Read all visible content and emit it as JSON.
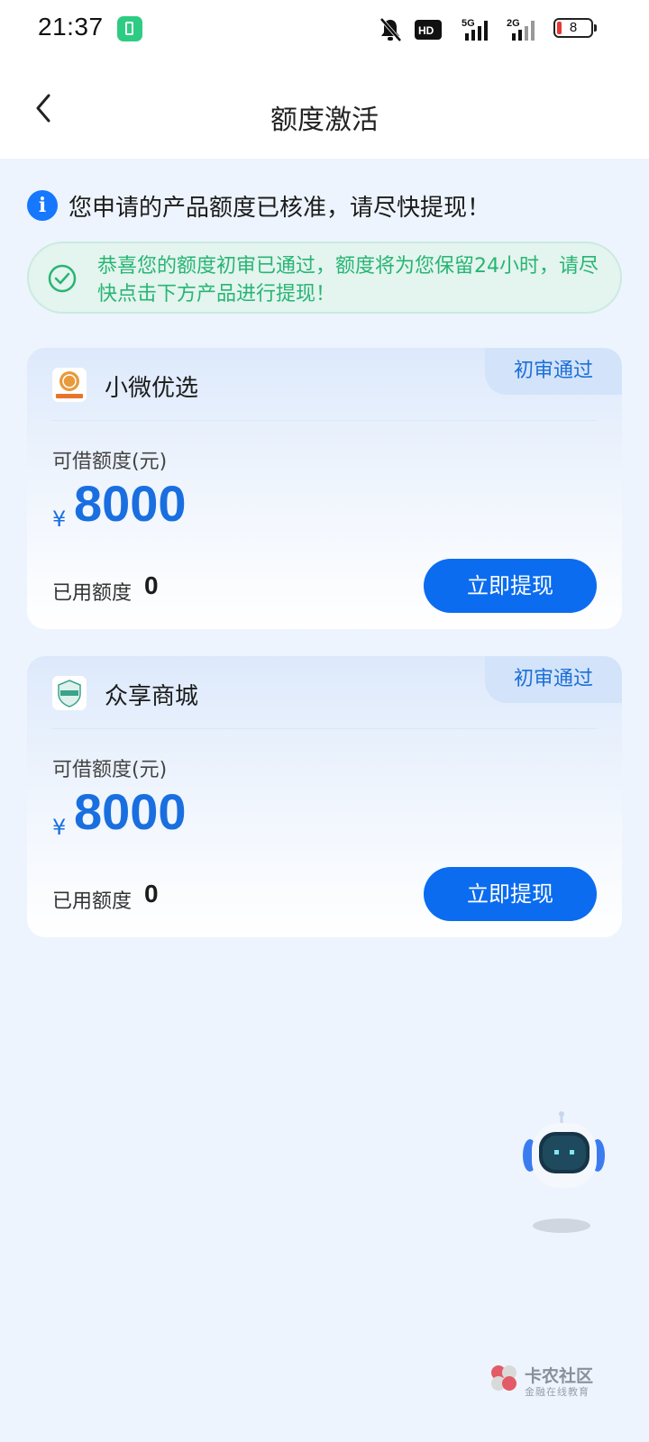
{
  "status_bar": {
    "time": "21:37",
    "battery_level": "8",
    "icons": [
      "charging-icon",
      "mute-icon",
      "hd-icon",
      "signal-5g-icon",
      "signal-2g-icon",
      "battery-icon"
    ]
  },
  "header": {
    "title": "额度激活"
  },
  "notice": {
    "text": "您申请的产品额度已核准，请尽快提现！"
  },
  "success_message": {
    "text": "恭喜您的额度初审已通过，额度将为您保留24小时，请尽快点击下方产品进行提现！"
  },
  "products": [
    {
      "name": "小微优选",
      "badge": "初审通过",
      "available_label": "可借额度(元)",
      "currency": "¥",
      "amount": "8000",
      "used_label": "已用额度",
      "used_value": "0",
      "button": "立即提现"
    },
    {
      "name": "众享商城",
      "badge": "初审通过",
      "available_label": "可借额度(元)",
      "currency": "¥",
      "amount": "8000",
      "used_label": "已用额度",
      "used_value": "0",
      "button": "立即提现"
    }
  ],
  "watermark": {
    "title": "卡农社区",
    "subtitle": "金融在线教育"
  },
  "colors": {
    "primary": "#0b6cf0",
    "amount": "#1a6fe0",
    "success": "#27b573",
    "background": "#edf4fd"
  }
}
